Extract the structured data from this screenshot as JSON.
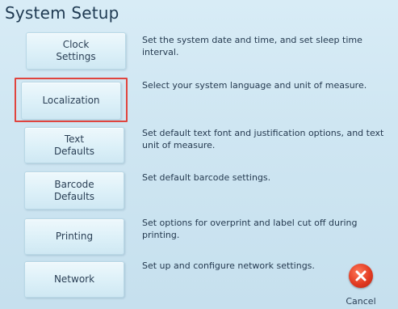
{
  "header": {
    "title": "System Setup"
  },
  "rows": [
    {
      "button": "Clock\nSettings",
      "desc": "Set the system date and time, and set sleep time interval."
    },
    {
      "button": "Localization",
      "desc": "Select your system language and unit of measure."
    },
    {
      "button": "Text\nDefaults",
      "desc": "Set default text font and justification options, and text unit of measure."
    },
    {
      "button": "Barcode\nDefaults",
      "desc": "Set default barcode settings."
    },
    {
      "button": "Printing",
      "desc": "Set options for overprint and label cut off during printing."
    },
    {
      "button": "Network",
      "desc": "Set up and configure network settings."
    }
  ],
  "cancel": {
    "label": "Cancel",
    "icon": "x-icon"
  },
  "colors": {
    "highlight": "#e0443e",
    "cancel": "#e23b22"
  }
}
